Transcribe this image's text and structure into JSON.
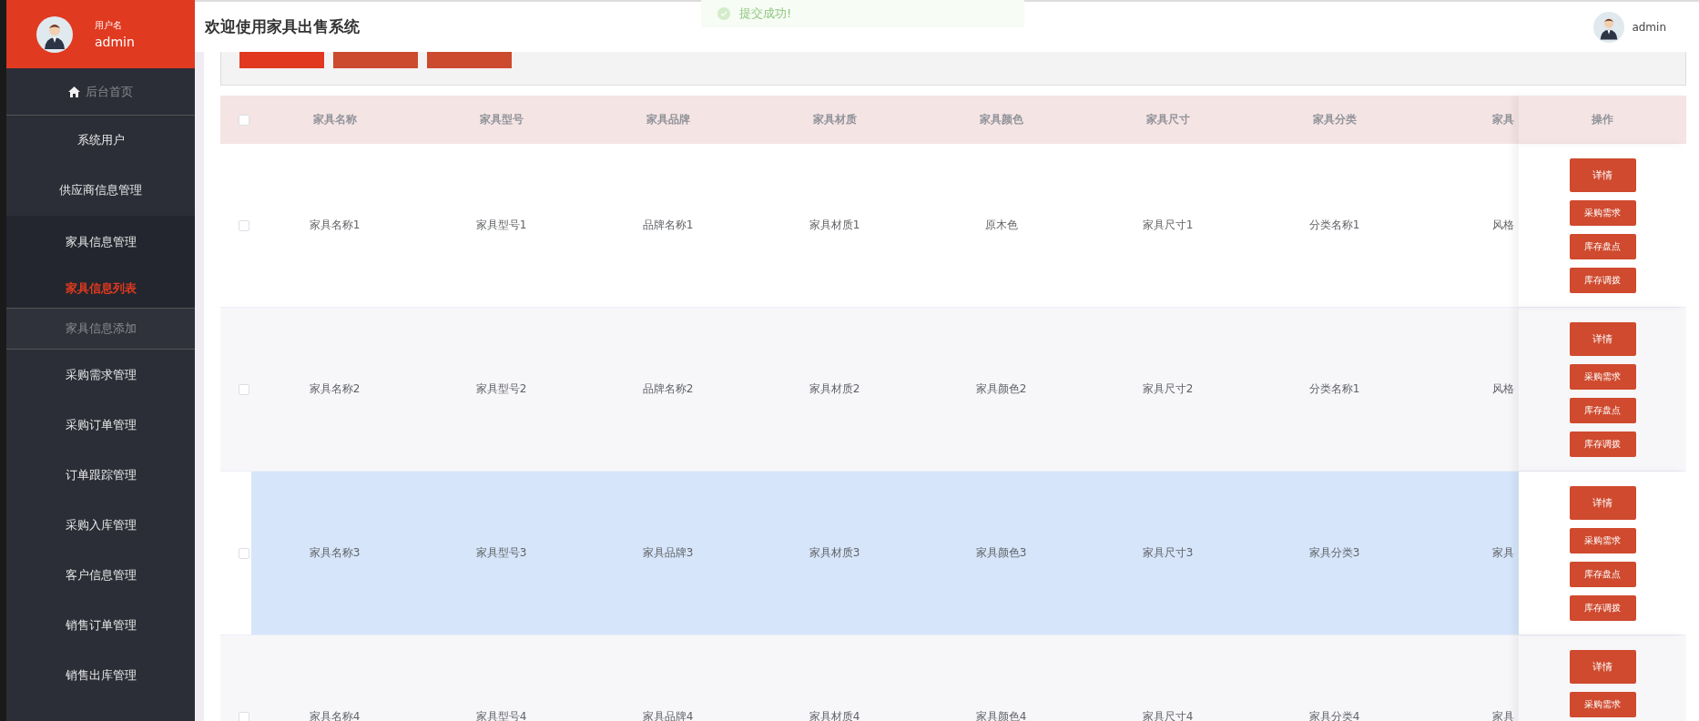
{
  "sidebar": {
    "user": {
      "label": "用户名",
      "name": "admin"
    },
    "menu": [
      {
        "kind": "home",
        "label": "后台首页",
        "selected": false
      },
      {
        "kind": "group",
        "label": "系统用户",
        "selected": false
      },
      {
        "kind": "group",
        "label": "供应商信息管理",
        "selected": false
      },
      {
        "kind": "group",
        "label": "家具信息管理",
        "selected": false,
        "expanded": true,
        "children": [
          {
            "label": "家具信息列表",
            "selected": true
          },
          {
            "label": "家具信息添加",
            "selected": false
          }
        ]
      },
      {
        "kind": "group",
        "label": "采购需求管理",
        "selected": false
      },
      {
        "kind": "group",
        "label": "采购订单管理",
        "selected": false
      },
      {
        "kind": "group",
        "label": "订单跟踪管理",
        "selected": false
      },
      {
        "kind": "group",
        "label": "采购入库管理",
        "selected": false
      },
      {
        "kind": "group",
        "label": "客户信息管理",
        "selected": false
      },
      {
        "kind": "group",
        "label": "销售订单管理",
        "selected": false
      },
      {
        "kind": "group",
        "label": "销售出库管理",
        "selected": false
      }
    ]
  },
  "header": {
    "title": "欢迎使用家具出售系统",
    "user": "admin"
  },
  "toast": {
    "message": "提交成功!"
  },
  "search_panel": {
    "buttons": [
      {
        "kind": "primary"
      },
      {
        "kind": "secondary"
      },
      {
        "kind": "secondary"
      }
    ]
  },
  "table": {
    "select_all": false,
    "columns": [
      "家具名称",
      "家具型号",
      "家具品牌",
      "家具材质",
      "家具颜色",
      "家具尺寸",
      "家具分类",
      "家具"
    ],
    "actions_column": "操作",
    "rows": [
      {
        "selected": false,
        "hovered": false,
        "cells": [
          "家具名称1",
          "家具型号1",
          "品牌名称1",
          "家具材质1",
          "原木色",
          "家具尺寸1",
          "分类名称1",
          "风格"
        ],
        "actions": [
          {
            "label": "详情",
            "kind": "main"
          },
          {
            "label": "采购需求",
            "kind": "small"
          },
          {
            "label": "库存盘点",
            "kind": "small"
          },
          {
            "label": "库存调拨",
            "kind": "small"
          }
        ]
      },
      {
        "selected": false,
        "hovered": false,
        "cells": [
          "家具名称2",
          "家具型号2",
          "品牌名称2",
          "家具材质2",
          "家具颜色2",
          "家具尺寸2",
          "分类名称1",
          "风格"
        ],
        "actions": [
          {
            "label": "详情",
            "kind": "main"
          },
          {
            "label": "采购需求",
            "kind": "small"
          },
          {
            "label": "库存盘点",
            "kind": "small"
          },
          {
            "label": "库存调拨",
            "kind": "small"
          }
        ]
      },
      {
        "selected": false,
        "hovered": true,
        "cells": [
          "家具名称3",
          "家具型号3",
          "家具品牌3",
          "家具材质3",
          "家具颜色3",
          "家具尺寸3",
          "家具分类3",
          "家具"
        ],
        "actions": [
          {
            "label": "详情",
            "kind": "main"
          },
          {
            "label": "采购需求",
            "kind": "small"
          },
          {
            "label": "库存盘点",
            "kind": "small"
          },
          {
            "label": "库存调拨",
            "kind": "small"
          }
        ]
      },
      {
        "selected": false,
        "hovered": false,
        "cells": [
          "家具名称4",
          "家具型号4",
          "家具品牌4",
          "家具材质4",
          "家具颜色4",
          "家具尺寸4",
          "家具分类4",
          "家具"
        ],
        "actions": [
          {
            "label": "详情",
            "kind": "main"
          },
          {
            "label": "采购需求",
            "kind": "small"
          }
        ]
      }
    ]
  }
}
